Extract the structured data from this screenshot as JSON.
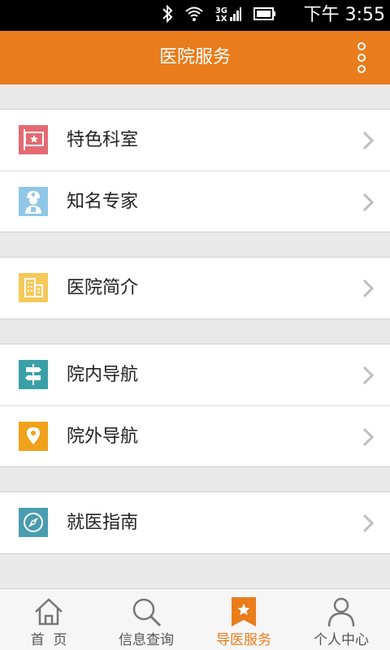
{
  "status_bar": {
    "network_label": "3G\n1X",
    "time": "下午 3:55",
    "icons": [
      "bluetooth-icon",
      "wifi-icon",
      "signal-icon",
      "battery-icon"
    ]
  },
  "header": {
    "title": "医院服务",
    "more_icon": "vertical-dots-icon"
  },
  "colors": {
    "accent": "#e97c1c",
    "icon_department": "#e46a72",
    "icon_expert": "#8fc7e6",
    "icon_intro": "#f5c95a",
    "icon_inner_nav": "#3aa0a8",
    "icon_outer_nav": "#f0a21a",
    "icon_guide": "#4a9cb0"
  },
  "menu": {
    "groups": [
      {
        "items": [
          {
            "label": "特色科室",
            "icon": "department-flag-icon"
          },
          {
            "label": "知名专家",
            "icon": "doctor-icon"
          }
        ]
      },
      {
        "items": [
          {
            "label": "医院简介",
            "icon": "building-icon"
          }
        ]
      },
      {
        "items": [
          {
            "label": "院内导航",
            "icon": "signpost-icon"
          },
          {
            "label": "院外导航",
            "icon": "location-pin-icon"
          }
        ]
      },
      {
        "items": [
          {
            "label": "就医指南",
            "icon": "compass-icon"
          }
        ]
      }
    ]
  },
  "bottom_nav": {
    "tabs": [
      {
        "label": "首  页",
        "icon": "home-icon",
        "active": false
      },
      {
        "label": "信息查询",
        "icon": "search-icon",
        "active": false
      },
      {
        "label": "导医服务",
        "icon": "bookmark-star-icon",
        "active": true
      },
      {
        "label": "个人中心",
        "icon": "person-icon",
        "active": false
      }
    ]
  }
}
